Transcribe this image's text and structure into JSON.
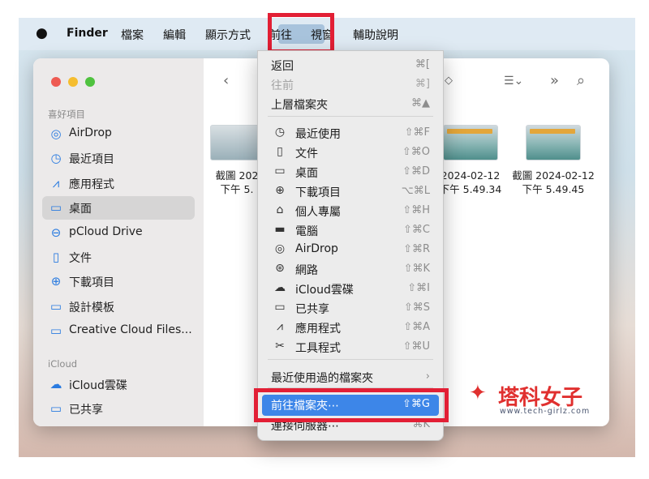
{
  "menubar": {
    "apple": "",
    "app": "Finder",
    "items": [
      "檔案",
      "編輯",
      "顯示方式",
      "前往",
      "視窗",
      "輔助說明"
    ]
  },
  "sidebar": {
    "favorites_header": "喜好項目",
    "favorites": [
      {
        "label": "AirDrop",
        "icon": "airdrop-icon",
        "glyph": "◎"
      },
      {
        "label": "最近項目",
        "icon": "clock-icon",
        "glyph": "◷"
      },
      {
        "label": "應用程式",
        "icon": "apps-icon",
        "glyph": "⩘"
      },
      {
        "label": "桌面",
        "icon": "desktop-icon",
        "glyph": "▭",
        "selected": true
      },
      {
        "label": "pCloud Drive",
        "icon": "drive-icon",
        "glyph": "⊖"
      },
      {
        "label": "文件",
        "icon": "document-icon",
        "glyph": "▯"
      },
      {
        "label": "下載項目",
        "icon": "download-icon",
        "glyph": "⊕"
      },
      {
        "label": "設計模板",
        "icon": "folder-icon",
        "glyph": "▭"
      },
      {
        "label": "Creative Cloud Files...",
        "icon": "folder-icon",
        "glyph": "▭"
      }
    ],
    "icloud_header": "iCloud",
    "icloud": [
      {
        "label": "iCloud雲碟",
        "icon": "cloud-icon",
        "glyph": "☁"
      },
      {
        "label": "已共享",
        "icon": "shared-folder-icon",
        "glyph": "▭"
      }
    ]
  },
  "files": [
    {
      "line1": "截圖 202",
      "line2": "下午 5."
    },
    {
      "line1": "2024-02-12",
      "line2": "下午 5.49.34"
    },
    {
      "line1": "截圖 2024-02-12",
      "line2": "下午 5.49.45"
    }
  ],
  "go_menu": {
    "items": [
      {
        "label": "返回",
        "shortcut": "⌘[",
        "name": "menu-back"
      },
      {
        "label": "往前",
        "shortcut": "⌘]",
        "disabled": true,
        "name": "menu-forward"
      },
      {
        "label": "上層檔案夾",
        "shortcut": "⌘▲",
        "name": "menu-enclosing-folder"
      },
      {
        "label": "最近使用",
        "shortcut": "⇧⌘F",
        "icon": "clock-icon",
        "glyph": "◷",
        "name": "menu-recents"
      },
      {
        "label": "文件",
        "shortcut": "⇧⌘O",
        "icon": "document-icon",
        "glyph": "▯",
        "name": "menu-documents"
      },
      {
        "label": "桌面",
        "shortcut": "⇧⌘D",
        "icon": "desktop-icon",
        "glyph": "▭",
        "name": "menu-desktop"
      },
      {
        "label": "下載項目",
        "shortcut": "⌥⌘L",
        "icon": "download-icon",
        "glyph": "⊕",
        "name": "menu-downloads"
      },
      {
        "label": "個人專屬",
        "shortcut": "⇧⌘H",
        "icon": "home-icon",
        "glyph": "⌂",
        "name": "menu-home"
      },
      {
        "label": "電腦",
        "shortcut": "⇧⌘C",
        "icon": "laptop-icon",
        "glyph": "▬",
        "name": "menu-computer"
      },
      {
        "label": "AirDrop",
        "shortcut": "⇧⌘R",
        "icon": "airdrop-icon",
        "glyph": "◎",
        "name": "menu-airdrop"
      },
      {
        "label": "網路",
        "shortcut": "⇧⌘K",
        "icon": "network-icon",
        "glyph": "⊛",
        "name": "menu-network"
      },
      {
        "label": "iCloud雲碟",
        "shortcut": "⇧⌘I",
        "icon": "cloud-icon",
        "glyph": "☁",
        "name": "menu-icloud"
      },
      {
        "label": "已共享",
        "shortcut": "⇧⌘S",
        "icon": "shared-folder-icon",
        "glyph": "▭",
        "name": "menu-shared"
      },
      {
        "label": "應用程式",
        "shortcut": "⇧⌘A",
        "icon": "apps-icon",
        "glyph": "⩘",
        "name": "menu-applications"
      },
      {
        "label": "工具程式",
        "shortcut": "⇧⌘U",
        "icon": "tools-icon",
        "glyph": "✂",
        "name": "menu-utilities"
      },
      {
        "label": "最近使用過的檔案夾",
        "shortcut": "›",
        "name": "menu-recent-folders"
      },
      {
        "label": "前往檔案夾⋯",
        "shortcut": "⇧⌘G",
        "highlight": true,
        "name": "menu-go-to-folder"
      },
      {
        "label": "連接伺服器⋯",
        "shortcut": "⌘K",
        "name": "menu-connect-server"
      }
    ]
  },
  "watermark": {
    "name": "塔科女子",
    "url": "www.tech-girlz.com"
  },
  "colors": {
    "accent": "#3d86e8",
    "highlight_frame": "#e21f35",
    "sidebar_icon": "#2a7be0"
  }
}
